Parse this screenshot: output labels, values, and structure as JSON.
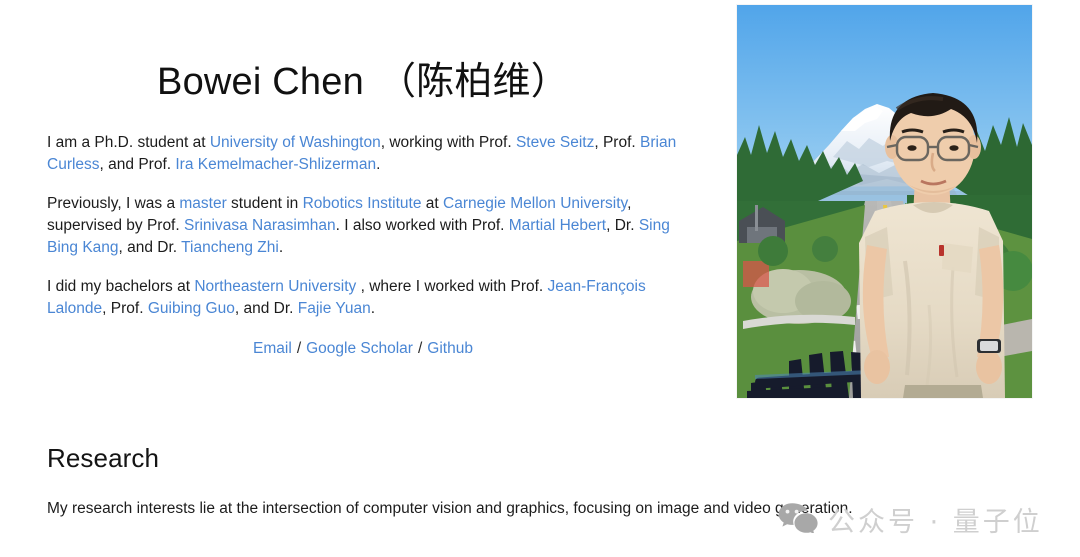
{
  "header": {
    "name_en": "Bowei Chen",
    "name_cn": "（陈柏维）"
  },
  "bio": {
    "p1": {
      "t1": "I am a Ph.D. student at ",
      "l1": "University of Washington",
      "t2": ", working with Prof. ",
      "l2": "Steve Seitz",
      "t3": ", Prof. ",
      "l3": "Brian Curless",
      "t4": ", and Prof. ",
      "l4": "Ira Kemelmacher-Shlizerman",
      "t5": "."
    },
    "p2": {
      "t1": "Previously, I was a ",
      "l1": "master",
      "t2": " student in ",
      "l2": "Robotics Institute",
      "t3": " at ",
      "l3": "Carnegie Mellon University",
      "t4": ", supervised by Prof. ",
      "l4": "Srinivasa Narasimhan",
      "t5": ". I also worked with Prof. ",
      "l5": "Martial Hebert",
      "t6": ", Dr. ",
      "l6": "Sing Bing Kang",
      "t7": ", and Dr. ",
      "l7": "Tiancheng Zhi",
      "t8": "."
    },
    "p3": {
      "t1": "I did my bachelors at ",
      "l1": "Northeastern University",
      "t2": " , where I worked with Prof. ",
      "l2": "Jean-François Lalonde",
      "t3": ", Prof. ",
      "l3": "Guibing Guo",
      "t4": ", and Dr. ",
      "l4": "Fajie Yuan",
      "t5": "."
    }
  },
  "social": {
    "email": "Email",
    "scholar": "Google Scholar",
    "github": "Github",
    "separator": "/"
  },
  "research": {
    "heading": "Research",
    "body": "My research interests lie at the intersection of computer vision and graphics, focusing on image and video generation."
  },
  "photo": {
    "alt": "Portrait photo of Bowei Chen standing on a lawn with Mount Rainier and a highway in the background"
  },
  "watermark": {
    "icon": "wechat-icon",
    "text": "公众号 · 量子位"
  },
  "colors": {
    "link": "#4a86d4",
    "text": "#1c1c1c",
    "background": "#ffffff",
    "watermark": "#cfcfcf"
  }
}
